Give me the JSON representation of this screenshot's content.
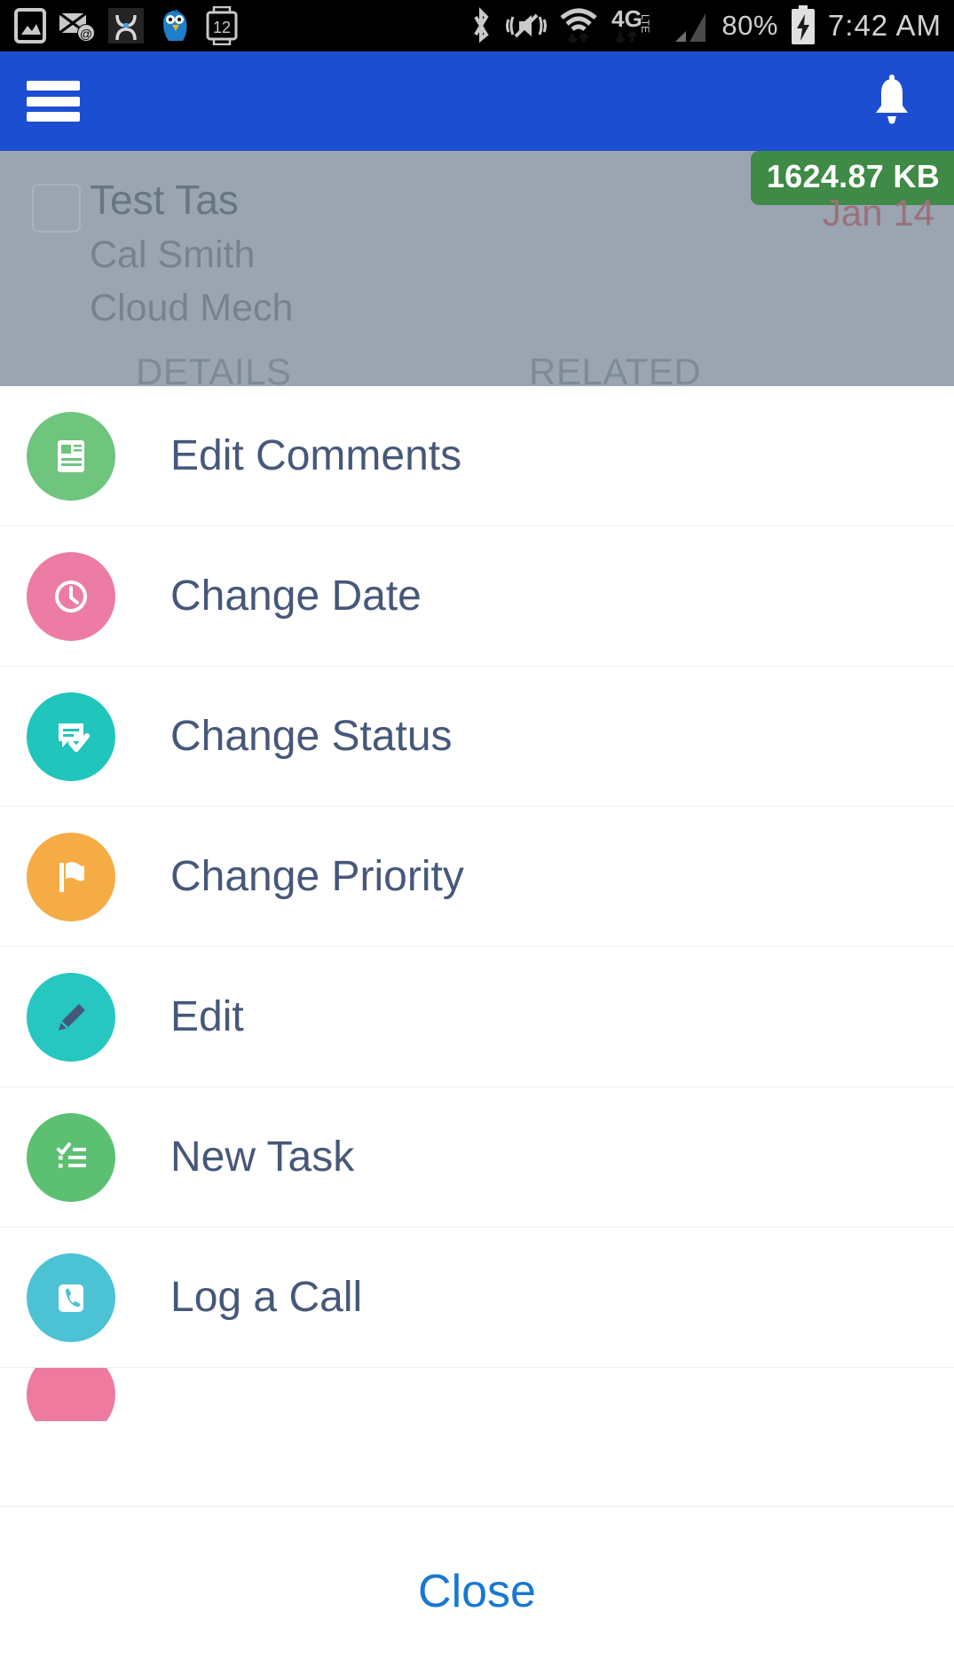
{
  "status_bar": {
    "icons_left": [
      "photo-icon",
      "email-at-icon",
      "app-dark-icon",
      "bird-icon",
      "watch-12-icon"
    ],
    "icons_right": [
      "bluetooth-icon",
      "vibrate-mute-icon",
      "wifi-transfer-icon",
      "4glte-icon",
      "signal-bars-icon"
    ],
    "watch_label": "12",
    "network_label": "4G",
    "network_sublabel": "LTE",
    "battery_percent": "80%",
    "clock": "7:42 AM"
  },
  "app_bar": {
    "menu_icon": "hamburger-menu-icon",
    "notification_icon": "bell-icon"
  },
  "backdrop": {
    "record_title": "Test Tas",
    "record_subtitle_1": "Cal Smith",
    "record_subtitle_2": "Cloud Mech",
    "size_badge": "1624.87 KB",
    "date_label": "Jan 14",
    "tabs": [
      {
        "label": "DETAILS"
      },
      {
        "label": "RELATED"
      }
    ]
  },
  "action_sheet": {
    "items": [
      {
        "label": "Edit Comments",
        "icon": "document-lines-icon",
        "color": "#6fc47e"
      },
      {
        "label": "Change Date",
        "icon": "clock-icon",
        "color": "#ed7ca5"
      },
      {
        "label": "Change Status",
        "icon": "chat-check-icon",
        "color": "#20c5bb"
      },
      {
        "label": "Change Priority",
        "icon": "flag-icon",
        "color": "#f5ac45"
      },
      {
        "label": "Edit",
        "icon": "pencil-icon",
        "color": "#25c7c0"
      },
      {
        "label": "New Task",
        "icon": "checklist-icon",
        "color": "#5cc072"
      },
      {
        "label": "Log a Call",
        "icon": "phone-icon",
        "color": "#4cc3d4"
      }
    ],
    "partial_item": {
      "icon": "circle-icon",
      "color": "#ee7a9f"
    },
    "close_label": "Close"
  },
  "colors": {
    "app_bar": "#1d4ed1",
    "backdrop": "#9aa5b1",
    "badge_green": "#3f8a46",
    "close_blue": "#1878d0",
    "label_navy": "#46587a"
  }
}
